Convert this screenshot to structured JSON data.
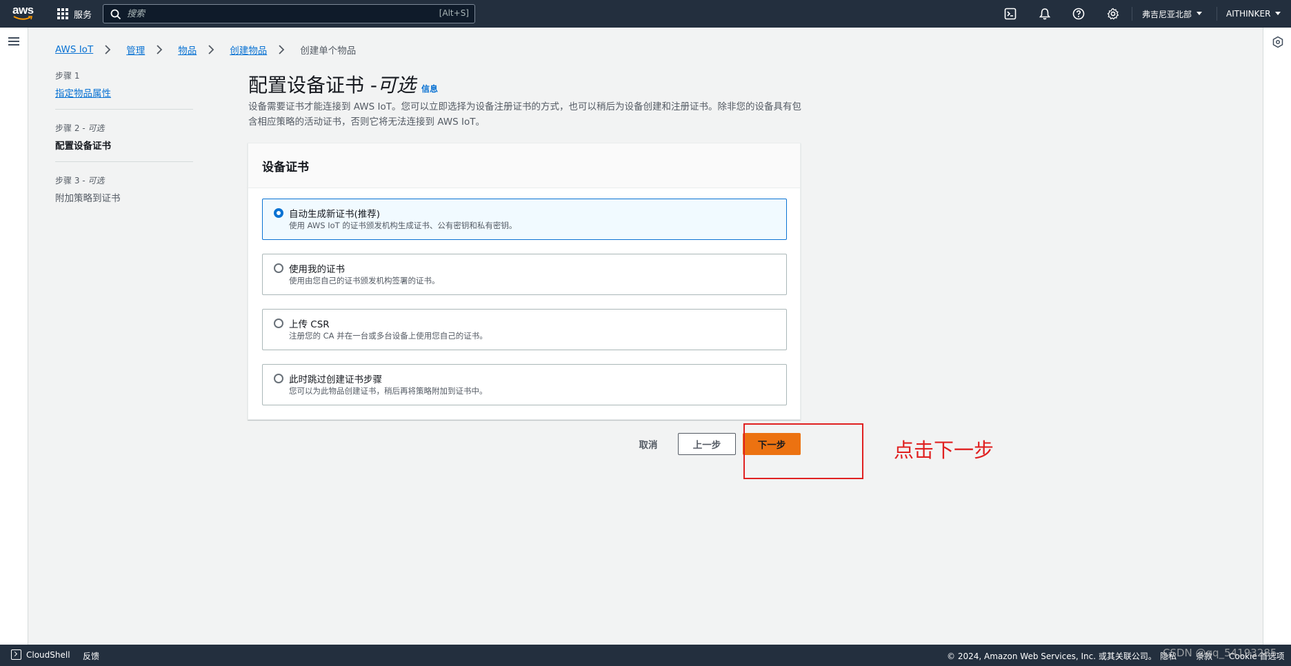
{
  "topnav": {
    "services_label": "服务",
    "search_placeholder": "搜索",
    "search_shortcut": "[Alt+S]",
    "region": "弗吉尼亚北部",
    "account": "AITHINKER"
  },
  "breadcrumb": {
    "items": [
      "AWS IoT",
      "管理",
      "物品",
      "创建物品"
    ],
    "current": "创建单个物品"
  },
  "steps": [
    {
      "label": "步骤 1",
      "optional": "",
      "name": "指定物品属性"
    },
    {
      "label": "步骤 2",
      "optional": " - 可选",
      "name": "配置设备证书"
    },
    {
      "label": "步骤 3",
      "optional": " - 可选",
      "name": "附加策略到证书"
    }
  ],
  "page": {
    "title": "配置设备证书 - ",
    "title_optional": "可选",
    "info": "信息",
    "description": "设备需要证书才能连接到 AWS IoT。您可以立即选择为设备注册证书的方式，也可以稍后为设备创建和注册证书。除非您的设备具有包含相应策略的活动证书，否则它将无法连接到 AWS IoT。"
  },
  "panel": {
    "title": "设备证书",
    "options": [
      {
        "title": "自动生成新证书(推荐)",
        "sub": "使用 AWS IoT 的证书颁发机构生成证书、公有密钥和私有密钥。",
        "selected": true
      },
      {
        "title": "使用我的证书",
        "sub": "使用由您自己的证书颁发机构签署的证书。",
        "selected": false
      },
      {
        "title": "上传 CSR",
        "sub": "注册您的 CA 并在一台或多台设备上使用您自己的证书。",
        "selected": false
      },
      {
        "title": "此时跳过创建证书步骤",
        "sub": "您可以为此物品创建证书，稍后再将策略附加到证书中。",
        "selected": false
      }
    ]
  },
  "actions": {
    "cancel": "取消",
    "previous": "上一步",
    "next": "下一步"
  },
  "annotation": {
    "text": "点击下一步",
    "color": "#e02020"
  },
  "footer": {
    "cloudshell": "CloudShell",
    "feedback": "反馈",
    "copyright": "© 2024, Amazon Web Services, Inc. 或其关联公司。",
    "privacy": "隐私",
    "terms": "条款",
    "cookie": "Cookie 首选项"
  },
  "watermark": "CSDN @qq_54193285",
  "colors": {
    "nav_bg": "#232f3e",
    "accent_link": "#0972d3",
    "primary_button": "#ec7211",
    "page_bg": "#f2f3f3"
  }
}
